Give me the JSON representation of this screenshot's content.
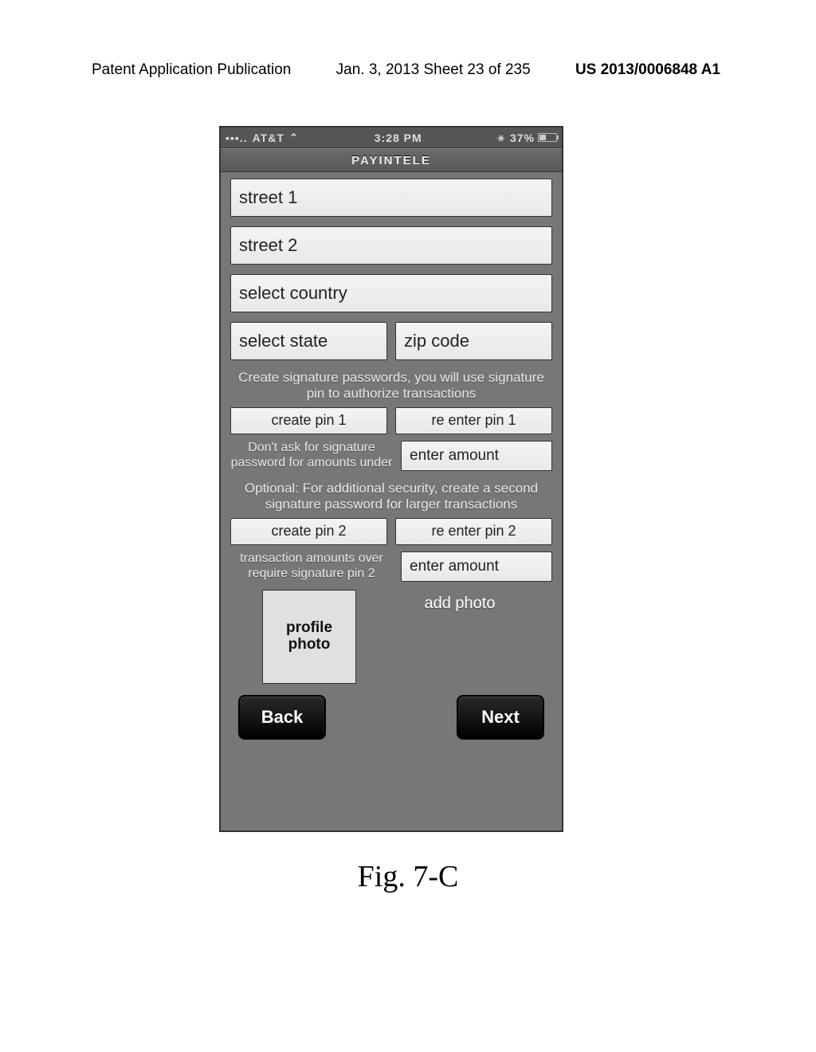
{
  "page_header": {
    "left": "Patent Application Publication",
    "center": "Jan. 3, 2013   Sheet 23 of 235",
    "right": "US 2013/0006848 A1"
  },
  "statusbar": {
    "carrier": "AT&T",
    "time": "3:28 PM",
    "battery_pct": "37%"
  },
  "app": {
    "title": "PAYINTELE"
  },
  "fields": {
    "street1": "street 1",
    "street2": "street 2",
    "country": "select country",
    "state": "select state",
    "zip": "zip code"
  },
  "pin1": {
    "help": "Create signature passwords, you will use signature pin to authorize transactions",
    "create": "create pin 1",
    "reenter": "re enter pin 1",
    "under_label": "Don't ask for signature password for amounts under",
    "amount": "enter amount"
  },
  "pin2": {
    "help": "Optional: For additional security, create a second signature password for larger transactions",
    "create": "create pin 2",
    "reenter": "re enter pin 2",
    "over_label": "transaction amounts over require signature pin 2",
    "amount": "enter amount"
  },
  "photo": {
    "box_label": "profile photo",
    "add_label": "add photo"
  },
  "nav": {
    "back": "Back",
    "next": "Next"
  },
  "figure_caption": "Fig. 7-C"
}
